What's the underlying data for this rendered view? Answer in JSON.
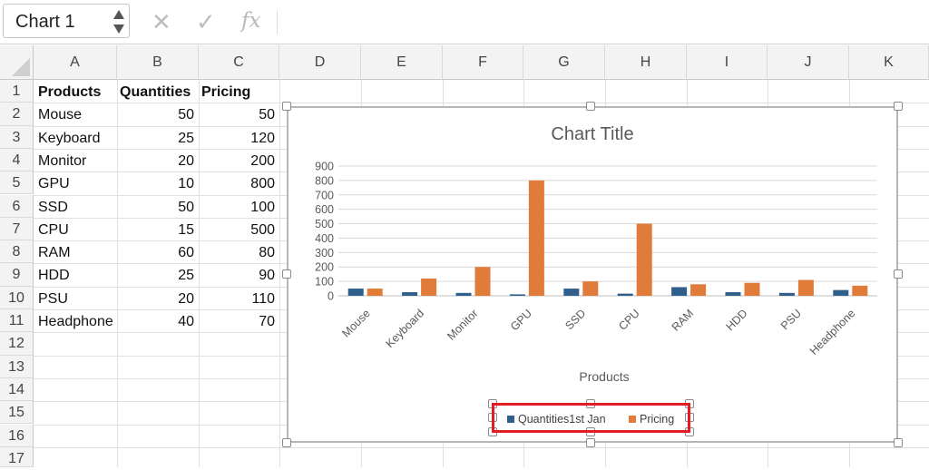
{
  "formula_bar": {
    "name_box": "Chart 1",
    "cancel_glyph": "✕",
    "enter_glyph": "✓",
    "fx_label": "fx"
  },
  "columns": [
    "A",
    "B",
    "C",
    "D",
    "E",
    "F",
    "G",
    "H",
    "I",
    "J",
    "K"
  ],
  "rows": [
    "1",
    "2",
    "3",
    "4",
    "5",
    "6",
    "7",
    "8",
    "9",
    "10",
    "11",
    "12",
    "13",
    "14",
    "15",
    "16",
    "17"
  ],
  "sheet": {
    "headers": [
      "Products",
      "Quantities",
      "Pricing"
    ],
    "data": [
      [
        "Mouse",
        "50",
        "50"
      ],
      [
        "Keyboard",
        "25",
        "120"
      ],
      [
        "Monitor",
        "20",
        "200"
      ],
      [
        "GPU",
        "10",
        "800"
      ],
      [
        "SSD",
        "50",
        "100"
      ],
      [
        "CPU",
        "15",
        "500"
      ],
      [
        "RAM",
        "60",
        "80"
      ],
      [
        "HDD",
        "25",
        "90"
      ],
      [
        "PSU",
        "20",
        "110"
      ],
      [
        "Headphone",
        "40",
        "70"
      ]
    ]
  },
  "chart_data": {
    "type": "bar",
    "title": "Chart Title",
    "xlabel": "Products",
    "ylabel": "",
    "categories": [
      "Mouse",
      "Keyboard",
      "Monitor",
      "GPU",
      "SSD",
      "CPU",
      "RAM",
      "HDD",
      "PSU",
      "Headphone"
    ],
    "series": [
      {
        "name": "Quantities1st Jan",
        "values": [
          50,
          25,
          20,
          10,
          50,
          15,
          60,
          25,
          20,
          40
        ],
        "color": "#2f5f8a"
      },
      {
        "name": "Pricing",
        "values": [
          50,
          120,
          200,
          800,
          100,
          500,
          80,
          90,
          110,
          70
        ],
        "color": "#e07b39"
      }
    ],
    "ylim": [
      0,
      900
    ],
    "yticks": [
      "0",
      "100",
      "200",
      "300",
      "400",
      "500",
      "600",
      "700",
      "800",
      "900"
    ],
    "grid": true,
    "legend_position": "bottom"
  },
  "colors": {
    "accent_highlight": "#e31b23",
    "series_quantities": "#2f5f8a",
    "series_pricing": "#e07b39"
  }
}
